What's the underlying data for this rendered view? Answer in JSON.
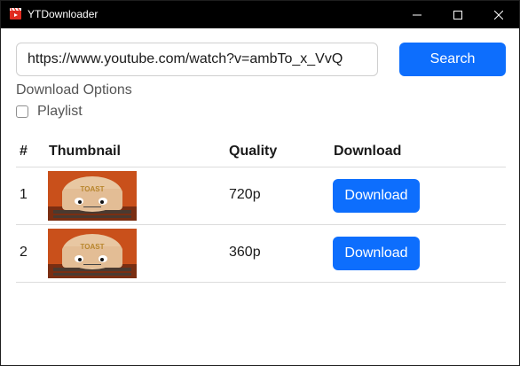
{
  "window": {
    "title": "YTDownloader",
    "icon": "app-icon",
    "controls": [
      "minimize-icon",
      "maximize-icon",
      "close-icon"
    ]
  },
  "search": {
    "url_value": "https://www.youtube.com/watch?v=ambTo_x_VvQ",
    "button_label": "Search"
  },
  "options": {
    "section_label": "Download Options",
    "playlist_label": "Playlist",
    "playlist_checked": false
  },
  "table": {
    "headers": [
      "#",
      "Thumbnail",
      "Quality",
      "Download"
    ],
    "rows": [
      {
        "num": "1",
        "thumbnail_text": "TOAST",
        "quality": "720p",
        "download_label": "Download"
      },
      {
        "num": "2",
        "thumbnail_text": "TOAST",
        "quality": "360p",
        "download_label": "Download"
      }
    ]
  },
  "colors": {
    "accent": "#0d6efd",
    "titlebar": "#000000"
  }
}
